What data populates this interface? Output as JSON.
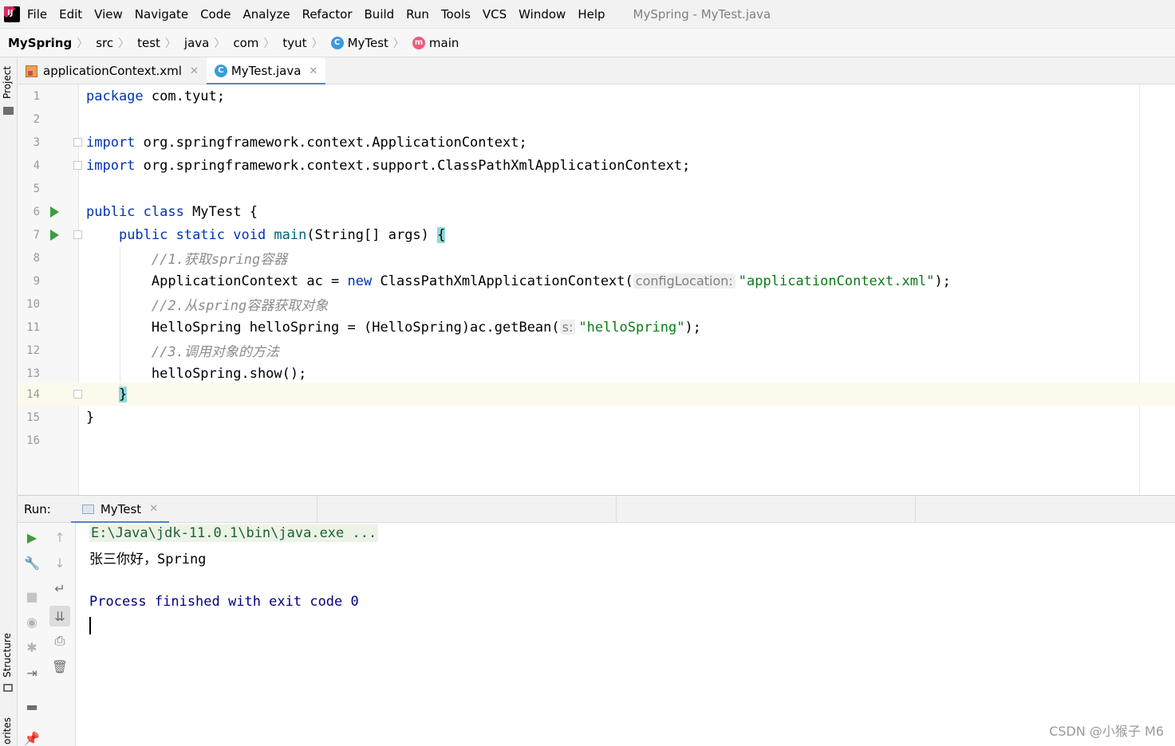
{
  "menubar": {
    "items": [
      {
        "label": "File"
      },
      {
        "label": "Edit"
      },
      {
        "label": "View"
      },
      {
        "label": "Navigate"
      },
      {
        "label": "Code"
      },
      {
        "label": "Analyze"
      },
      {
        "label": "Refactor"
      },
      {
        "label": "Build"
      },
      {
        "label": "Run"
      },
      {
        "label": "Tools"
      },
      {
        "label": "VCS"
      },
      {
        "label": "Window"
      },
      {
        "label": "Help"
      }
    ],
    "window_title": "MySpring - MyTest.java"
  },
  "breadcrumbs": [
    "MySpring",
    "src",
    "test",
    "java",
    "com",
    "tyut",
    "MyTest",
    "main"
  ],
  "side_labels": {
    "project": "Project",
    "structure": "Structure",
    "favorites": "orites"
  },
  "tabs": [
    {
      "label": "applicationContext.xml",
      "active": false
    },
    {
      "label": "MyTest.java",
      "active": true
    }
  ],
  "code": {
    "line_numbers": [
      "1",
      "2",
      "3",
      "4",
      "5",
      "6",
      "7",
      "8",
      "9",
      "10",
      "11",
      "12",
      "13",
      "14",
      "15",
      "16"
    ],
    "l1_kw": "package",
    "l1_rest": " com.tyut;",
    "l3_kw": "import",
    "l3_rest": " org.springframework.context.ApplicationContext;",
    "l4_kw": "import",
    "l4_rest": " org.springframework.context.support.ClassPathXmlApplicationContext;",
    "l6_kw": "public class",
    "l6_rest": " MyTest {",
    "l7_kw": "public static void",
    "l7_name": " main",
    "l7_rest": "(String[] args) ",
    "l7_brace": "{",
    "l8": "//1.获取spring容器",
    "l9_a": "ApplicationContext ac = ",
    "l9_kw": "new",
    "l9_b": " ClassPathXmlApplicationContext(",
    "l9_hint": "configLocation:",
    "l9_str": "\"applicationContext.xml\"",
    "l9_c": ");",
    "l10": "//2.从spring容器获取对象",
    "l11_a": "HelloSpring helloSpring = (HelloSpring)ac.getBean(",
    "l11_hint": "s:",
    "l11_str": "\"helloSpring\"",
    "l11_c": ");",
    "l12": "//3.调用对象的方法",
    "l13": "helloSpring.show();",
    "l14": "}",
    "l15": "}"
  },
  "run": {
    "label": "Run:",
    "tab": "MyTest",
    "lines": {
      "cmd": "E:\\Java\\jdk-11.0.1\\bin\\java.exe ...",
      "out": "张三你好，Spring",
      "exit": "Process finished with exit code 0"
    }
  },
  "watermark": "CSDN @小猴子 M6"
}
